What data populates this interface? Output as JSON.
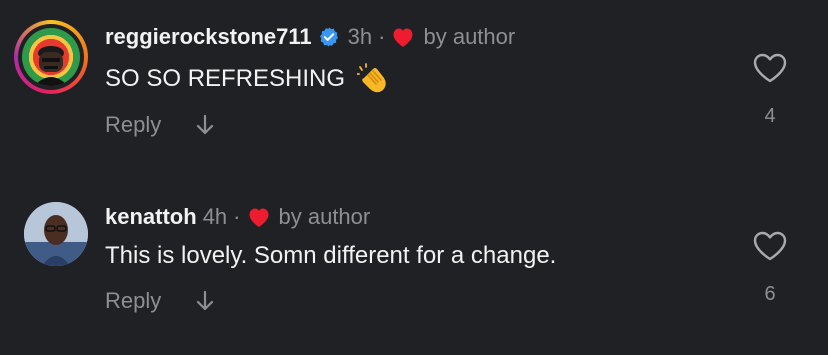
{
  "comments": [
    {
      "username": "reggierockstone711",
      "verified": true,
      "time": "3h",
      "separator": "·",
      "author_tag": "by author",
      "text": "SO SO REFRESHING",
      "emoji": "clapping-hands",
      "reply_label": "Reply",
      "like_count": "4"
    },
    {
      "username": "kenattoh",
      "verified": false,
      "time": "4h",
      "separator": "·",
      "author_tag": "by author",
      "text": "This is lovely. Somn different for a change.",
      "reply_label": "Reply",
      "like_count": "6"
    }
  ],
  "colors": {
    "background": "#202125",
    "primary_text": "#f2f2f2",
    "secondary_text": "#8e8e93",
    "verified_blue": "#3897f0",
    "author_heart": "#ed1c2e"
  },
  "icons": {
    "verified": "verified-badge-icon",
    "author_heart": "heart-filled-icon",
    "like": "heart-outline-icon",
    "expand": "arrow-down-icon"
  }
}
